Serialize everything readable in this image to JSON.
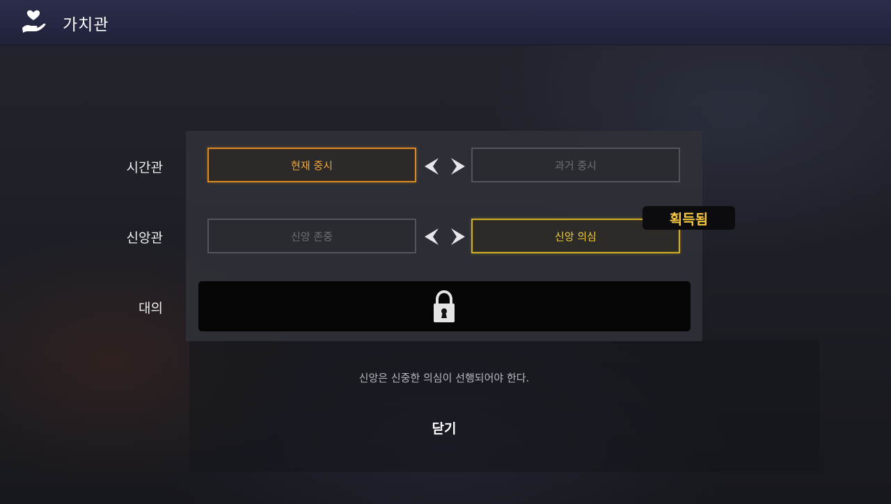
{
  "header": {
    "title": "가치관",
    "icon": "heart-hand-icon"
  },
  "rows": [
    {
      "label": "시간관",
      "left_option": "현재 중시",
      "right_option": "과거 중시",
      "selected": "left",
      "selected_color": "#d88a2a"
    },
    {
      "label": "신앙관",
      "left_option": "신앙 존중",
      "right_option": "신앙 의심",
      "selected": "right",
      "selected_color": "#cfae2c",
      "badge": "획득됨"
    },
    {
      "label": "대의",
      "locked": true,
      "icon": "padlock-icon"
    }
  ],
  "description": "신앙은 신중한 의심이 선행되어야 한다.",
  "close_label": "닫기",
  "colors": {
    "header_bg": "#252641",
    "badge_text": "#f5c842",
    "unselected_text": "#6f7076"
  }
}
